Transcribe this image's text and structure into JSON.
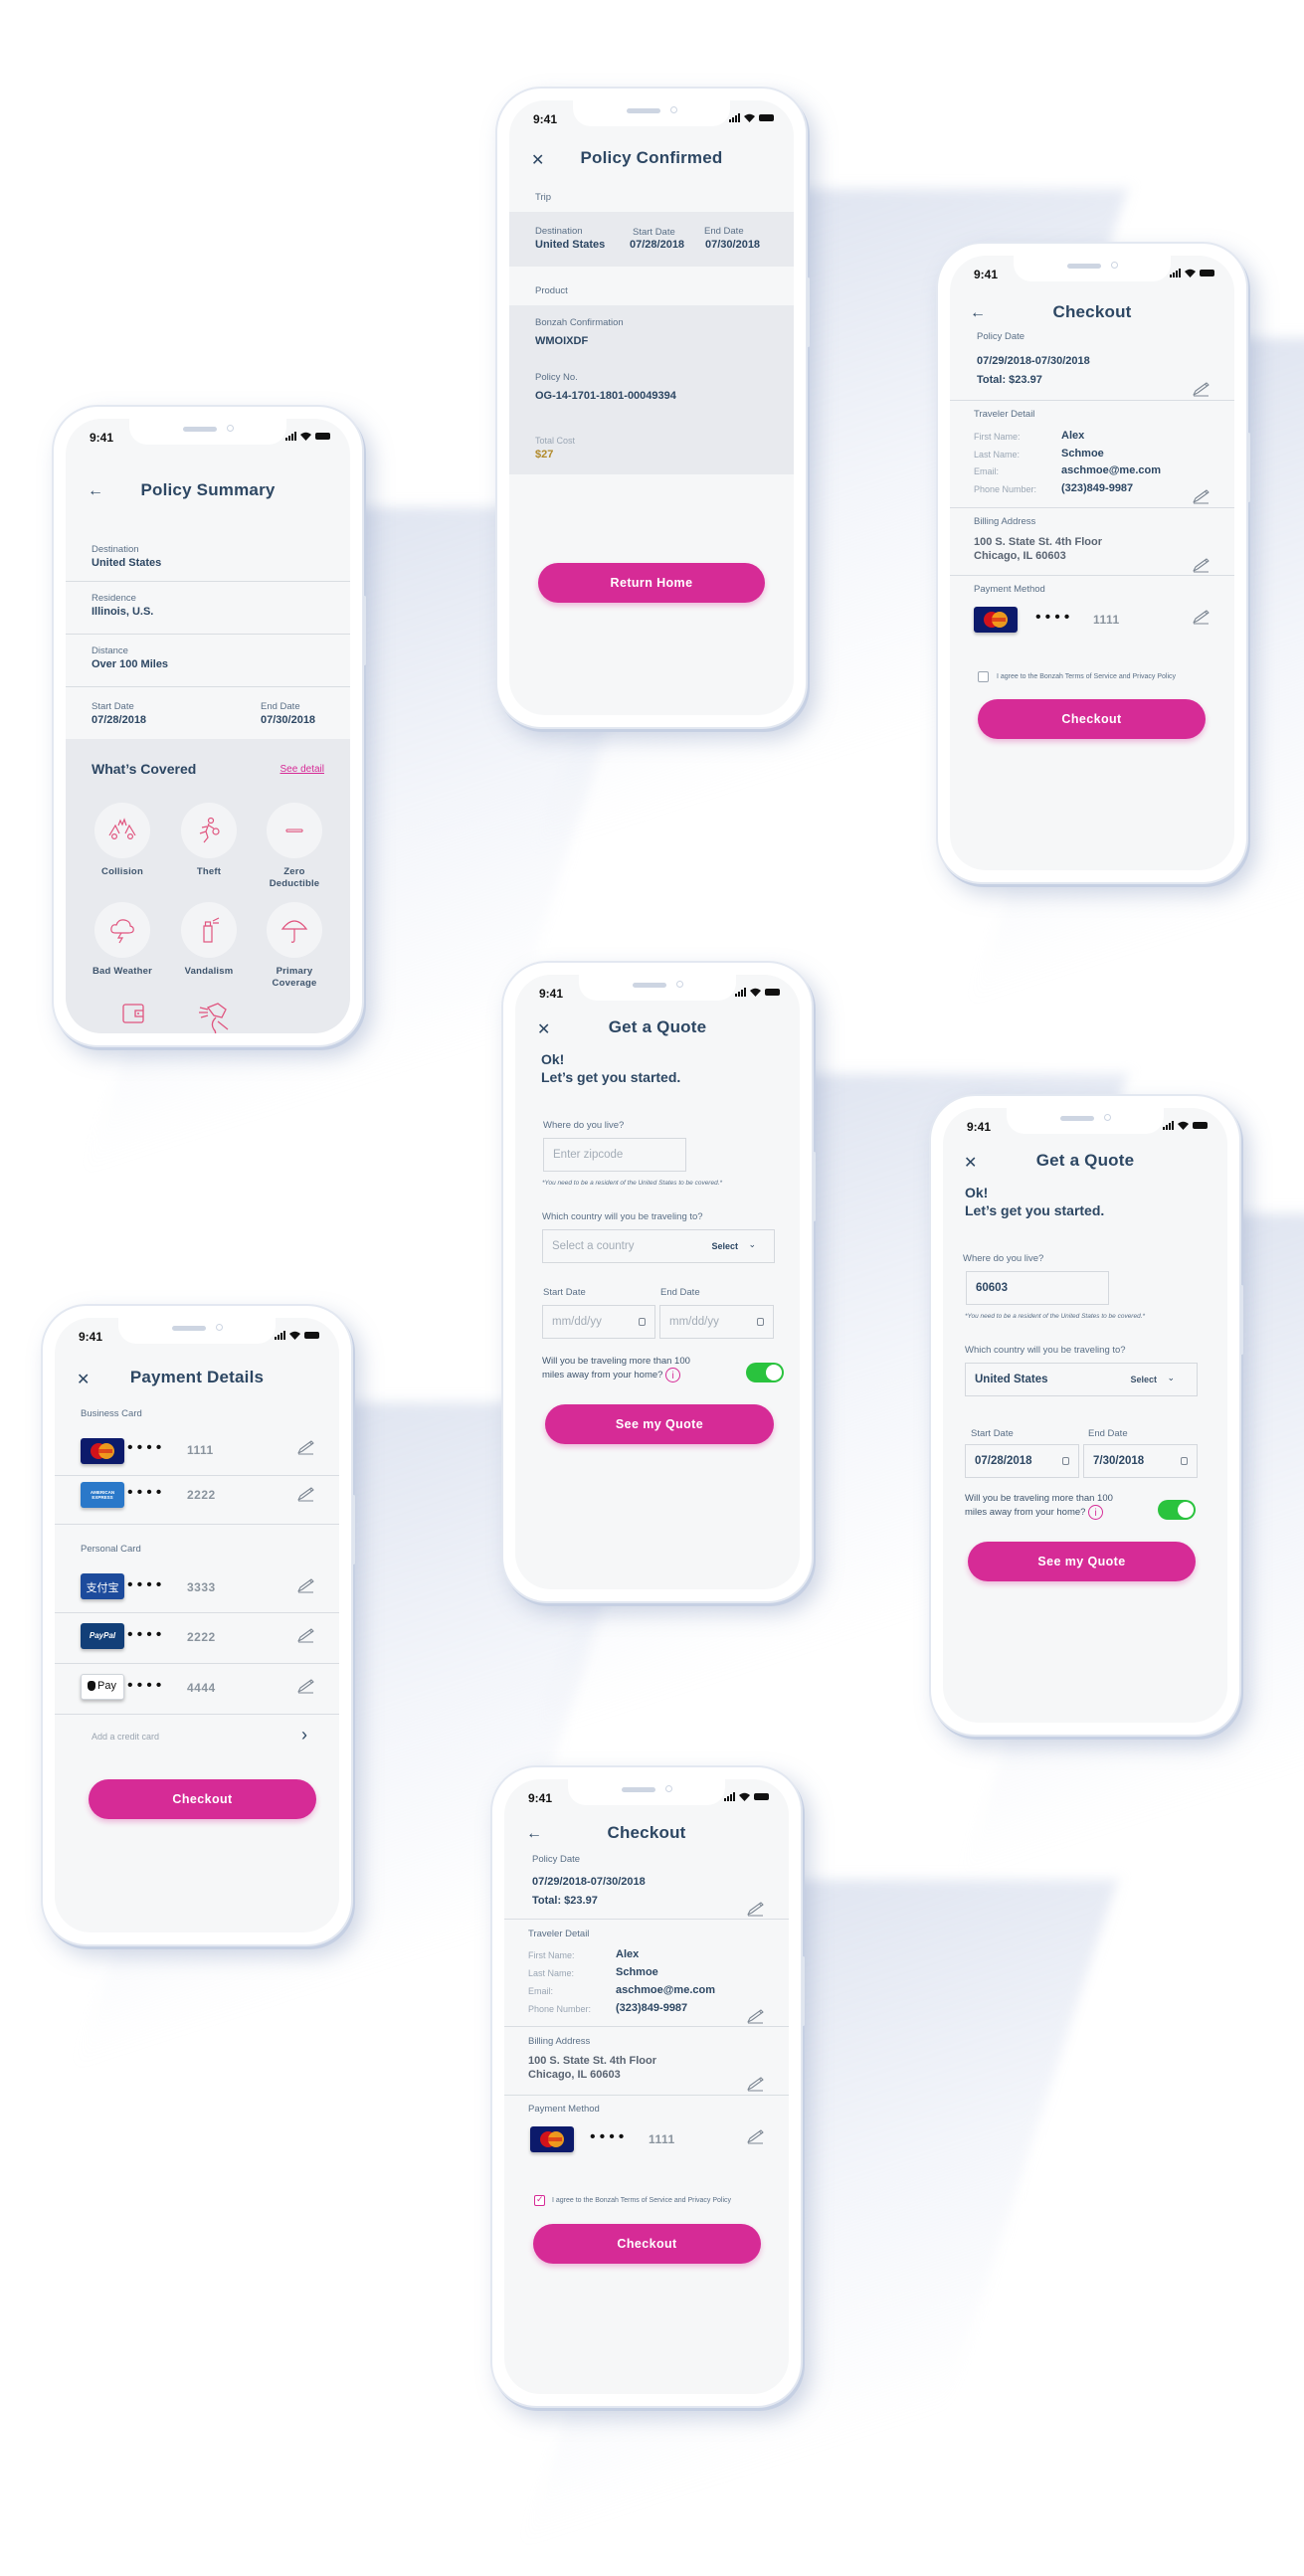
{
  "status_bar": {
    "time": "9:41"
  },
  "brand_colors": {
    "primary": "#d62b96",
    "text": "#2d4763",
    "toggle_on": "#2ac33e",
    "mastercard_bg": "#0c1a6b"
  },
  "policy_confirmed": {
    "title": "Policy Confirmed",
    "close_icon": "close-icon",
    "trip_label": "Trip",
    "destination_label": "Destination",
    "destination_value": "United States",
    "start_label": "Start Date",
    "start_value": "07/28/2018",
    "end_label": "End Date",
    "end_value": "07/30/2018",
    "product_label": "Product",
    "confirmation_label": "Bonzah Confirmation",
    "confirmation_value": "WMOIXDF",
    "policy_label": "Policy No.",
    "policy_value": "OG-14-1701-1801-00049394",
    "cost_label": "Total Cost",
    "cost_value": "$27",
    "return_button": "Return Home"
  },
  "policy_summary": {
    "title": "Policy Summary",
    "back_icon": "arrow-left-icon",
    "rows": [
      {
        "label": "Destination",
        "value": "United States"
      },
      {
        "label": "Residence",
        "value": "Illinois, U.S."
      },
      {
        "label": "Distance",
        "value": "Over 100 Miles"
      }
    ],
    "start_label": "Start Date",
    "start_value": "07/28/2018",
    "end_label": "End Date",
    "end_value": "07/30/2018",
    "covered_title": "What’s Covered",
    "see_detail": "See detail",
    "coverage": [
      {
        "label": "Collision",
        "icon": "collision-icon"
      },
      {
        "label": "Theft",
        "icon": "theft-icon"
      },
      {
        "label": "Zero Deductible",
        "icon": "minus-icon"
      },
      {
        "label": "Bad Weather",
        "icon": "storm-icon"
      },
      {
        "label": "Vandalism",
        "icon": "spray-can-icon"
      },
      {
        "label": "Primary Coverage",
        "icon": "umbrella-icon"
      }
    ]
  },
  "checkout": {
    "title": "Checkout",
    "policy_date_label": "Policy Date",
    "policy_dates": "07/29/2018-07/30/2018",
    "total": "Total: $23.97",
    "traveler_label": "Traveler Detail",
    "traveler": [
      {
        "label": "First Name:",
        "value": "Alex"
      },
      {
        "label": "Last Name:",
        "value": "Schmoe"
      },
      {
        "label": "Email:",
        "value": "aschmoe@me.com"
      },
      {
        "label": "Phone Number:",
        "value": "(323)849-9987"
      }
    ],
    "billing_label": "Billing Address",
    "billing_line1": "100 S. State St. 4th Floor",
    "billing_line2": "Chicago, IL 60603",
    "payment_label": "Payment Method",
    "card_dots": "••••",
    "card_last4": "1111",
    "card_brand": "MasterCard",
    "agree_text": "I agree to the Bonzah Terms of Service and Privacy Policy",
    "checkout_button": "Checkout",
    "agree_checked_top": false,
    "agree_checked_bottom": true
  },
  "quote_empty": {
    "title": "Get a Quote",
    "greeting_1": "Ok!",
    "greeting_2": "Let’s get you started.",
    "live_label": "Where do you live?",
    "zip_placeholder": "Enter zipcode",
    "resident_note": "*You need to be a resident of the United States to be covered.*",
    "country_label": "Which country will you be traveling to?",
    "country_placeholder": "Select a country",
    "select_label": "Select",
    "start_label": "Start Date",
    "end_label": "End Date",
    "date_placeholder": "mm/dd/yy",
    "distance_question": "Will you be traveling more than 100 miles away from your home?",
    "distance_toggle_on": true,
    "quote_button": "See my Quote"
  },
  "quote_filled": {
    "title": "Get a Quote",
    "greeting_1": "Ok!",
    "greeting_2": "Let’s get you started.",
    "live_label": "Where do you live?",
    "zip_value": "60603",
    "resident_note": "*You need to be a resident of the United States to be covered.*",
    "country_label": "Which country will you be traveling to?",
    "country_value": "United States",
    "select_label": "Select",
    "start_label": "Start Date",
    "start_value": "07/28/2018",
    "end_label": "End Date",
    "end_value": "7/30/2018",
    "distance_question": "Will you be traveling more than 100 miles away from your home?",
    "distance_toggle_on": true,
    "quote_button": "See my Quote"
  },
  "payment_details": {
    "title": "Payment Details",
    "business_label": "Business Card",
    "personal_label": "Personal Card",
    "dots": "••••",
    "business_cards": [
      {
        "brand": "MasterCard",
        "last4": "1111"
      },
      {
        "brand": "American Express",
        "last4": "2222"
      }
    ],
    "personal_cards": [
      {
        "brand": "Alipay",
        "last4": "3333"
      },
      {
        "brand": "PayPal",
        "last4": "2222"
      },
      {
        "brand": "Apple Pay",
        "last4": "4444"
      }
    ],
    "amex_text": "AMERICAN EXPRESS",
    "alipay_text": "支付宝",
    "paypal_text": "PayPal",
    "applepay_text": "Pay",
    "add_card": "Add a credit card",
    "checkout_button": "Checkout"
  }
}
